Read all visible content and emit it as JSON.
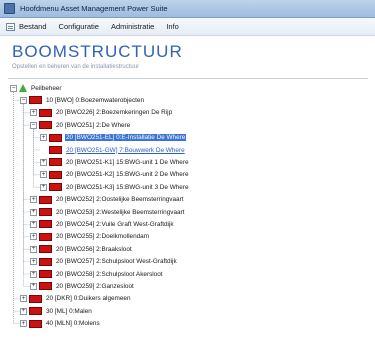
{
  "window": {
    "title": "Hoofdmenu Asset Management Power Suite"
  },
  "menu": {
    "items": [
      {
        "label": "Bestand",
        "icon": "list-icon"
      },
      {
        "label": "Configuratie"
      },
      {
        "label": "Administratie"
      },
      {
        "label": "Info"
      }
    ]
  },
  "header": {
    "title": "BOOMSTRUCTUUR",
    "subtitle": "Opstellen en beheren van de installatiestructuur"
  },
  "colors": {
    "heading": "#2f62b8",
    "selection": "#3b74d6",
    "node_icon": "#cc1111",
    "root_icon": "#3fae3a"
  },
  "tree": {
    "nodes": [
      {
        "label": "Peilbeheer",
        "depth": 0,
        "toggle": "−",
        "icon": "root-triangle-icon"
      },
      {
        "label": "10 [BWO] 0:Boezemwaterobjecten",
        "depth": 1,
        "toggle": "−",
        "icon": "node-icon"
      },
      {
        "label": "20 [BWO226] 2:Boezemkeringen De Rijp",
        "depth": 2,
        "toggle": "+",
        "icon": "node-icon"
      },
      {
        "label": "20 [BWO251] 2:De Where",
        "depth": 2,
        "toggle": "−",
        "icon": "node-icon"
      },
      {
        "label": "20 [BWO251-EL] 0:E-Installatie De Where",
        "depth": 3,
        "toggle": "+",
        "icon": "node-icon",
        "state": "selected"
      },
      {
        "label": "20 [BWO251-GW] 7:Bouwwerk De Where",
        "depth": 3,
        "toggle": "",
        "icon": "node-icon",
        "state": "link"
      },
      {
        "label": "20 [BWO251-K1] 15:BWG-unit 1 De Where",
        "depth": 3,
        "toggle": "+",
        "icon": "node-icon"
      },
      {
        "label": "20 [BWO251-K2] 15:BWG-unit 2 De Where",
        "depth": 3,
        "toggle": "+",
        "icon": "node-icon"
      },
      {
        "label": "20 [BWO251-K3] 15:BWG-unit 3 De Where",
        "depth": 3,
        "toggle": "+",
        "icon": "node-icon"
      },
      {
        "label": "20 [BWO252] 2:Oostelijke Beemsterringvaart",
        "depth": 2,
        "toggle": "+",
        "icon": "node-icon"
      },
      {
        "label": "20 [BWO253] 2:Westelijke Beemsterringvaart",
        "depth": 2,
        "toggle": "+",
        "icon": "node-icon"
      },
      {
        "label": "20 [BWO254] 2:Vuile Graft West-Graftdijk",
        "depth": 2,
        "toggle": "+",
        "icon": "node-icon"
      },
      {
        "label": "20 [BWO255] 2:Doelkmollendam",
        "depth": 2,
        "toggle": "+",
        "icon": "node-icon"
      },
      {
        "label": "20 [BWO256] 2:Braaksloot",
        "depth": 2,
        "toggle": "+",
        "icon": "node-icon"
      },
      {
        "label": "20 [BWO257] 2:Schulpsloot West-Graftdijk",
        "depth": 2,
        "toggle": "+",
        "icon": "node-icon"
      },
      {
        "label": "20 [BWO258] 2:Schulpsloot Akersloot",
        "depth": 2,
        "toggle": "+",
        "icon": "node-icon"
      },
      {
        "label": "20 [BWO259] 2:Ganzesloot",
        "depth": 2,
        "toggle": "+",
        "icon": "node-icon"
      },
      {
        "label": "20 [DKR] 0:Duikers algemeen",
        "depth": 1,
        "toggle": "+",
        "icon": "node-icon"
      },
      {
        "label": "30 [ML] 0:Malen",
        "depth": 1,
        "toggle": "+",
        "icon": "node-icon"
      },
      {
        "label": "40 [MLN] 0:Molens",
        "depth": 1,
        "toggle": "+",
        "icon": "node-icon"
      }
    ]
  }
}
